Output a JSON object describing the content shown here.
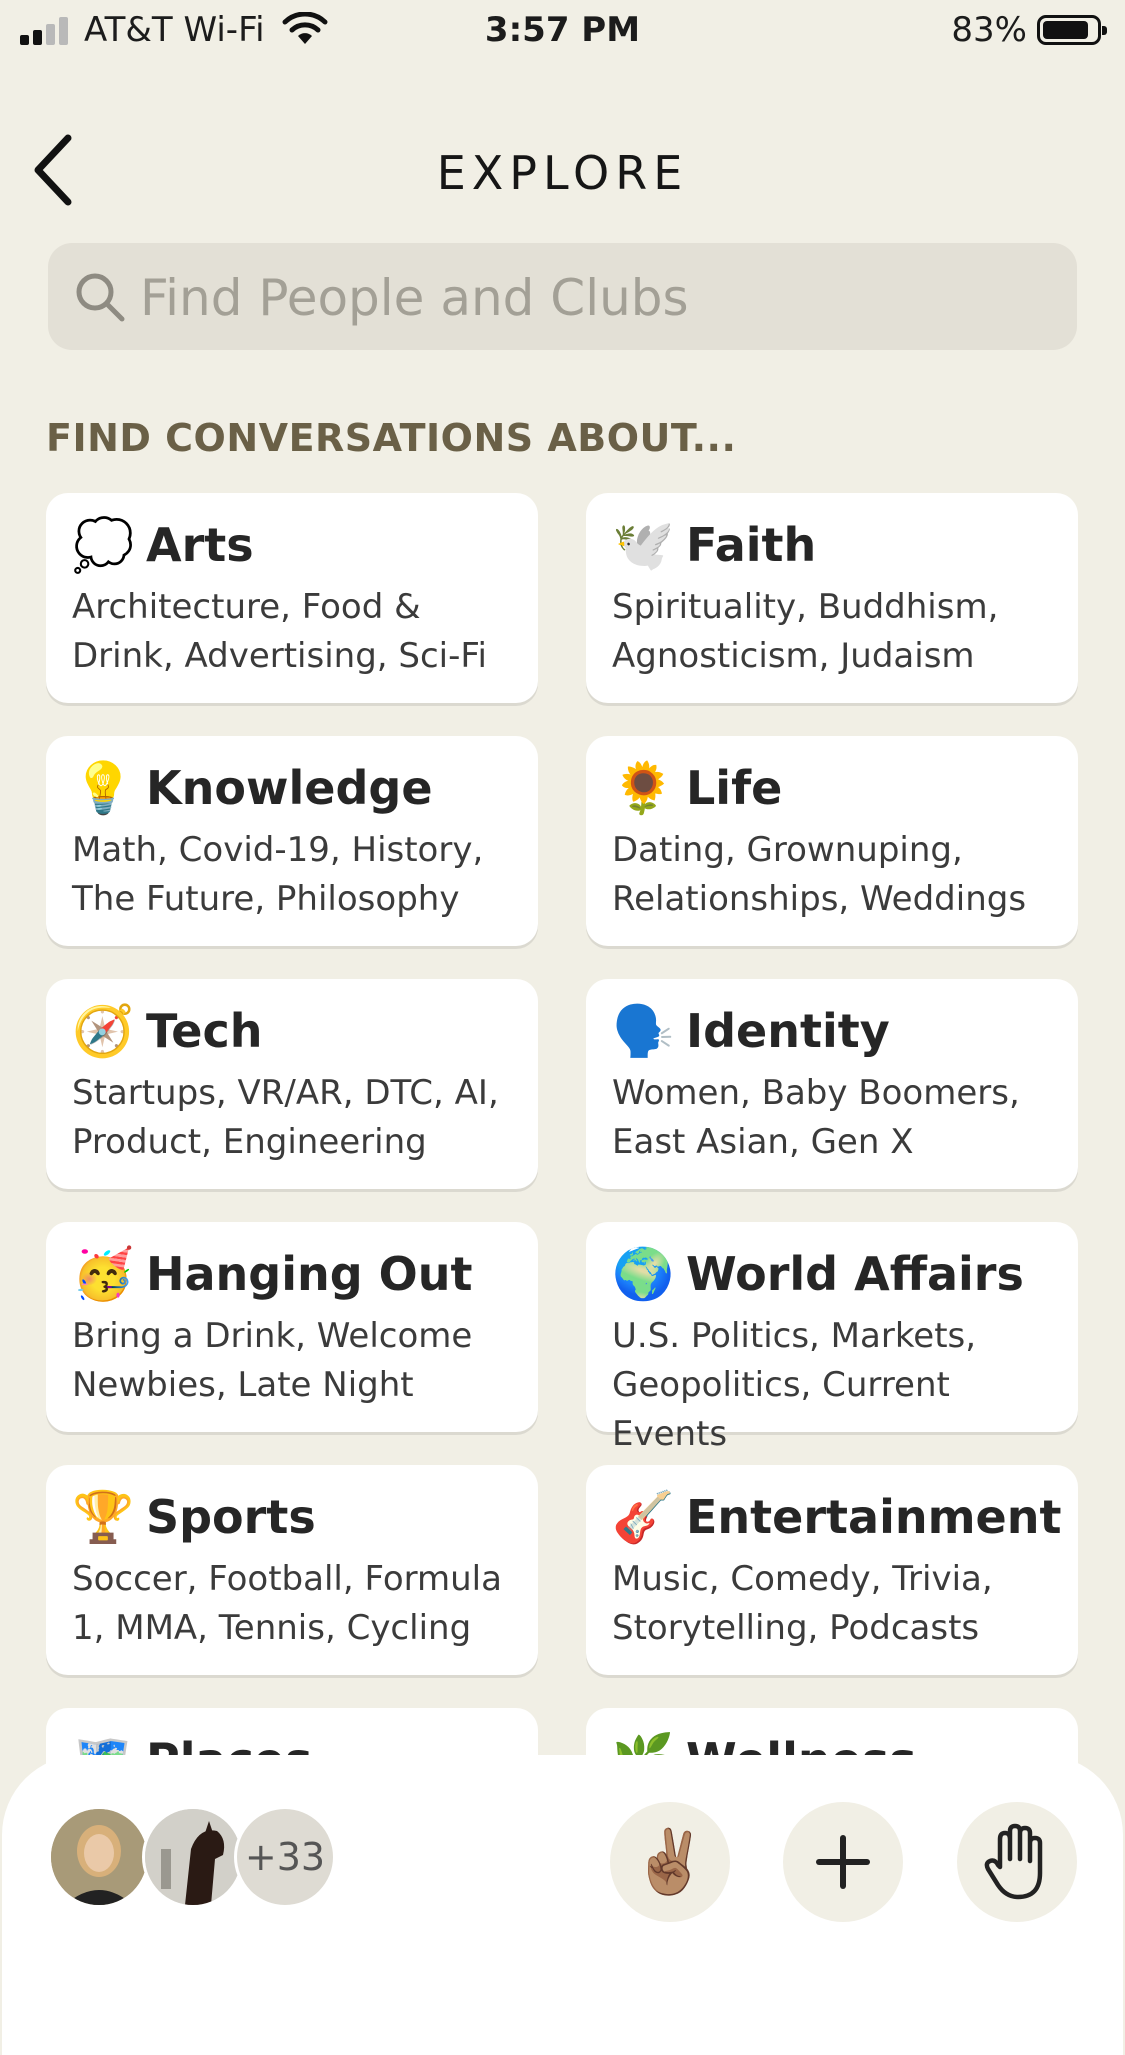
{
  "status_bar": {
    "carrier": "AT&T Wi-Fi",
    "time": "3:57 PM",
    "battery_percent": "83%",
    "battery_level": 0.83,
    "signal_bars": 2
  },
  "header": {
    "back_icon": "chevron-left-icon",
    "title": "EXPLORE"
  },
  "search": {
    "icon": "search-icon",
    "placeholder": "Find People and Clubs"
  },
  "section": {
    "heading": "FIND CONVERSATIONS ABOUT..."
  },
  "categories": [
    {
      "emoji": "💭",
      "name": "Arts",
      "description": "Architecture, Food & Drink, Advertising, Sci-Fi"
    },
    {
      "emoji": "🕊️",
      "name": "Faith",
      "description": "Spirituality, Buddhism, Agnosticism, Judaism"
    },
    {
      "emoji": "💡",
      "name": "Knowledge",
      "description": "Math, Covid-19, History, The Future, Philosophy"
    },
    {
      "emoji": "🌻",
      "name": "Life",
      "description": "Dating, Grownuping, Relationships, Weddings"
    },
    {
      "emoji": "🧭",
      "name": "Tech",
      "description": "Startups, VR/AR, DTC, AI, Product, Engineering"
    },
    {
      "emoji": "🗣️",
      "name": "Identity",
      "description": "Women, Baby Boomers, East Asian, Gen X"
    },
    {
      "emoji": "🥳",
      "name": "Hanging Out",
      "description": "Bring a Drink, Welcome Newbies, Late Night"
    },
    {
      "emoji": "🌍",
      "name": "World Affairs",
      "description": "U.S. Politics, Markets, Geopolitics, Current Events"
    },
    {
      "emoji": "🏆",
      "name": "Sports",
      "description": "Soccer, Football, Formula 1, MMA, Tennis, Cycling"
    },
    {
      "emoji": "🎸",
      "name": "Entertainment",
      "description": "Music, Comedy, Trivia, Storytelling, Podcasts"
    },
    {
      "emoji": "🗺️",
      "name": "Places",
      "description": ""
    },
    {
      "emoji": "🌿",
      "name": "Wellness",
      "description": ""
    }
  ],
  "bottom_bar": {
    "more_count": "+33",
    "peace_emoji": "✌🏽",
    "icons": {
      "avatar_1": "person-avatar",
      "avatar_2": "horse-avatar",
      "add": "plus-icon",
      "raise_hand": "raised-hand-icon"
    }
  },
  "colors": {
    "background": "#F1EFE5",
    "search_field": "#E3E0D6",
    "section_heading": "#6A6047",
    "card": "#FFFFFF"
  }
}
